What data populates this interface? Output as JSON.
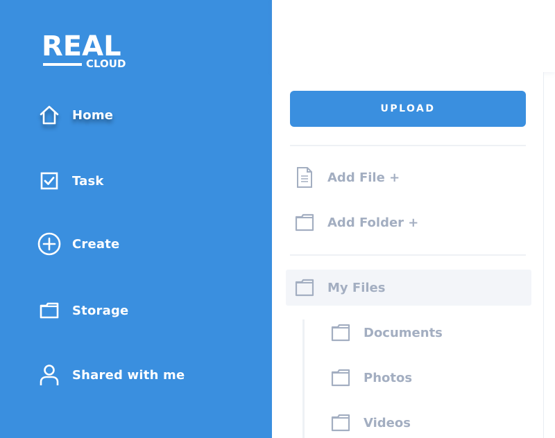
{
  "brand": {
    "main": "REAL",
    "sub": "CLOUD"
  },
  "sidebar": {
    "items": [
      {
        "label": "Home",
        "icon": "home-icon",
        "active": true
      },
      {
        "label": "Task",
        "icon": "checkbox-icon"
      },
      {
        "label": "Create",
        "icon": "plus-circle-icon"
      },
      {
        "label": "Storage",
        "icon": "folder-icon"
      },
      {
        "label": "Shared with me",
        "icon": "user-icon"
      }
    ]
  },
  "panel": {
    "upload_label": "UPLOAD",
    "actions": [
      {
        "label": "Add File +",
        "icon": "file-icon"
      },
      {
        "label": "Add Folder +",
        "icon": "folder-icon"
      }
    ],
    "tree": {
      "root": {
        "label": "My Files",
        "icon": "folder-icon"
      },
      "children": [
        {
          "label": "Documents",
          "icon": "folder-icon"
        },
        {
          "label": "Photos",
          "icon": "folder-icon"
        },
        {
          "label": "Videos",
          "icon": "folder-icon"
        }
      ]
    }
  },
  "colors": {
    "accent": "#3a8fdf",
    "muted_text": "#a3aec1",
    "selected_bg": "#f3f5f9"
  }
}
